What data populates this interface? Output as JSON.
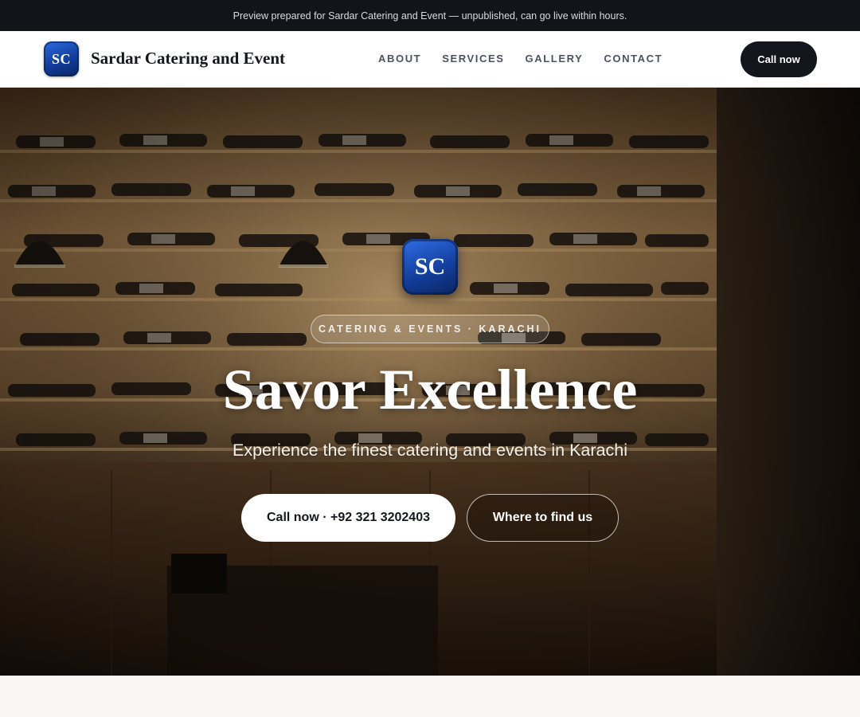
{
  "banner": {
    "text": "Preview prepared for Sardar Catering and Event — unpublished, can go live within hours."
  },
  "header": {
    "logo_initials": "SC",
    "brand_name": "Sardar Catering and Event",
    "nav": [
      {
        "label": "ABOUT"
      },
      {
        "label": "SERVICES"
      },
      {
        "label": "GALLERY"
      },
      {
        "label": "CONTACT"
      }
    ],
    "call_label": "Call now"
  },
  "hero": {
    "logo_initials": "SC",
    "tag": "CATERING & EVENTS · KARACHI",
    "title": "Savor Excellence",
    "subtitle": "Experience the finest catering and events in Karachi",
    "primary_button": "Call now · +92 321 3202403",
    "secondary_button": "Where to find us",
    "background_image": "wine-bottle-wall-restaurant-photo"
  },
  "colors": {
    "dark": "#12141a",
    "brand_blue": "#1a4fb8",
    "page_background": "#f8f7f3"
  }
}
